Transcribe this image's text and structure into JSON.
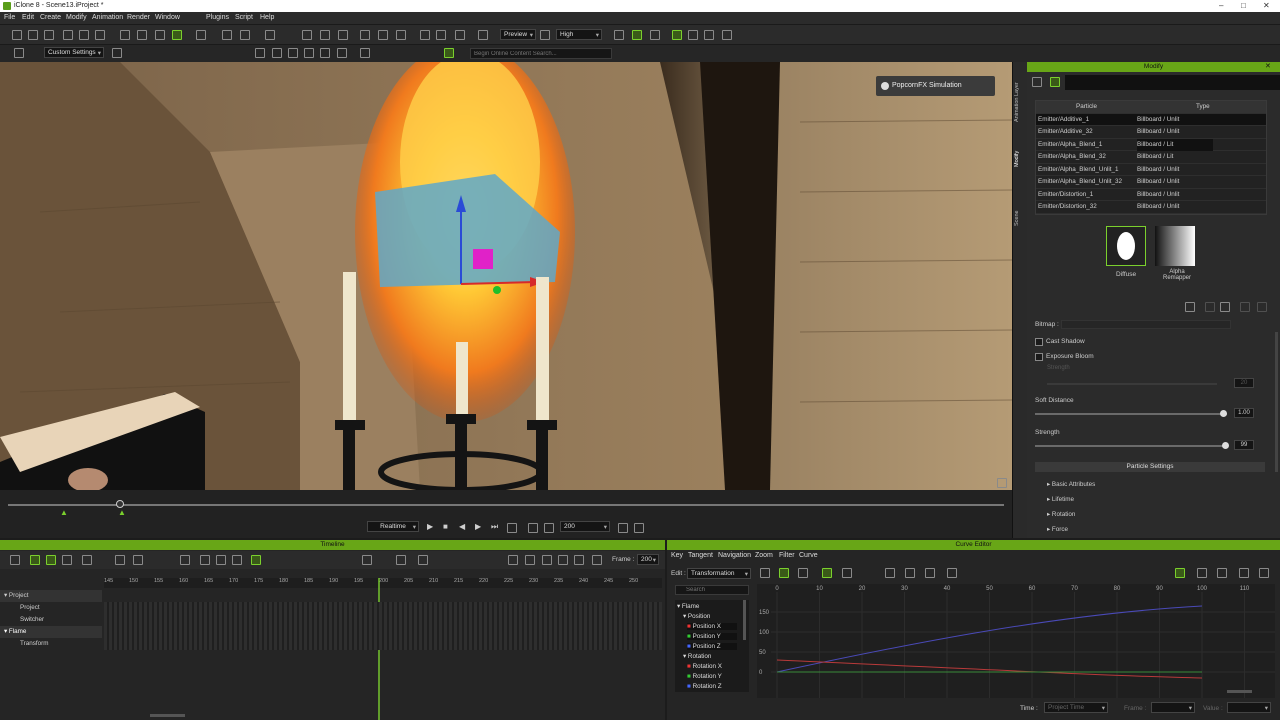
{
  "window": {
    "title": "iClone 8 - Scene13.iProject *"
  },
  "menu": [
    "File",
    "Edit",
    "Create",
    "Modify",
    "Animation",
    "Render",
    "Window",
    "Plugins",
    "Script",
    "Help"
  ],
  "toolbar": {
    "preview": "Preview",
    "quality": "High",
    "custom_settings": "Custom Settings",
    "search_placeholder": "Begin Online Content Search..."
  },
  "viewport": {
    "popcorn_label": "PopcornFX Simulation"
  },
  "playback": {
    "mode": "Realtime",
    "frame": "200"
  },
  "side_tabs": [
    "Animation Layer",
    "Modify",
    "Scene"
  ],
  "modify": {
    "title": "Modify",
    "columns": [
      "Particle",
      "Type"
    ],
    "rows": [
      {
        "particle": "Emitter/Additive_1",
        "type": "Billboard / Unlit"
      },
      {
        "particle": "Emitter/Additive_32",
        "type": "Billboard / Unlit"
      },
      {
        "particle": "Emitter/Alpha_Blend_1",
        "type": "Billboard / Lit"
      },
      {
        "particle": "Emitter/Alpha_Blend_32",
        "type": "Billboard / Lit"
      },
      {
        "particle": "Emitter/Alpha_Blend_Unlit_1",
        "type": "Billboard / Unlit"
      },
      {
        "particle": "Emitter/Alpha_Blend_Unlit_32",
        "type": "Billboard / Unlit"
      },
      {
        "particle": "Emitter/Distortion_1",
        "type": "Billboard / Unlit"
      },
      {
        "particle": "Emitter/Distortion_32",
        "type": "Billboard / Unlit"
      }
    ],
    "diffuse": "Diffuse",
    "alpha_remapper": "Alpha Remapper",
    "bitmap": "Bitmap :",
    "cast_shadow": "Cast Shadow",
    "exposure_bloom": "Exposure Bloom",
    "strength_dim": "Strength",
    "strength_dim_value": "20",
    "soft_distance": "Soft Distance",
    "soft_distance_value": "1.00",
    "soft_distance_level": 0.98,
    "strength": "Strength",
    "strength_value": "99",
    "strength_level": 0.99,
    "particle_settings": "Particle Settings",
    "settings_items": [
      "Basic Attributes",
      "Lifetime",
      "Rotation",
      "Force"
    ]
  },
  "timeline": {
    "title": "Timeline",
    "frame_label": "Frame :",
    "frame": "200",
    "ticks": [
      "145",
      "150",
      "155",
      "160",
      "165",
      "170",
      "175",
      "180",
      "185",
      "190",
      "195",
      "200",
      "205",
      "210",
      "215",
      "220",
      "225",
      "230",
      "235",
      "240",
      "245",
      "250"
    ],
    "tracks": [
      "Project",
      "Project",
      "Switcher",
      "Flame",
      "Transform"
    ]
  },
  "curve": {
    "title": "Curve Editor",
    "menu": [
      "Key",
      "Tangent",
      "Navigation",
      "Zoom",
      "Filter",
      "Curve"
    ],
    "edit_label": "Edit :",
    "edit_value": "Transformation",
    "search_placeholder": "Search",
    "tree": [
      "Flame",
      "Position",
      "Position X",
      "Position Y",
      "Position Z",
      "Rotation",
      "Rotation X",
      "Rotation Y",
      "Rotation Z"
    ],
    "xticks": [
      "0",
      "10",
      "20",
      "30",
      "40",
      "50",
      "60",
      "70",
      "80",
      "90",
      "100",
      "110"
    ],
    "yticks": [
      "150",
      "100",
      "50",
      "0"
    ],
    "time_label": "Time :",
    "time_value": "Project Time",
    "frame_label": "Frame :",
    "value_label": "Value :"
  }
}
